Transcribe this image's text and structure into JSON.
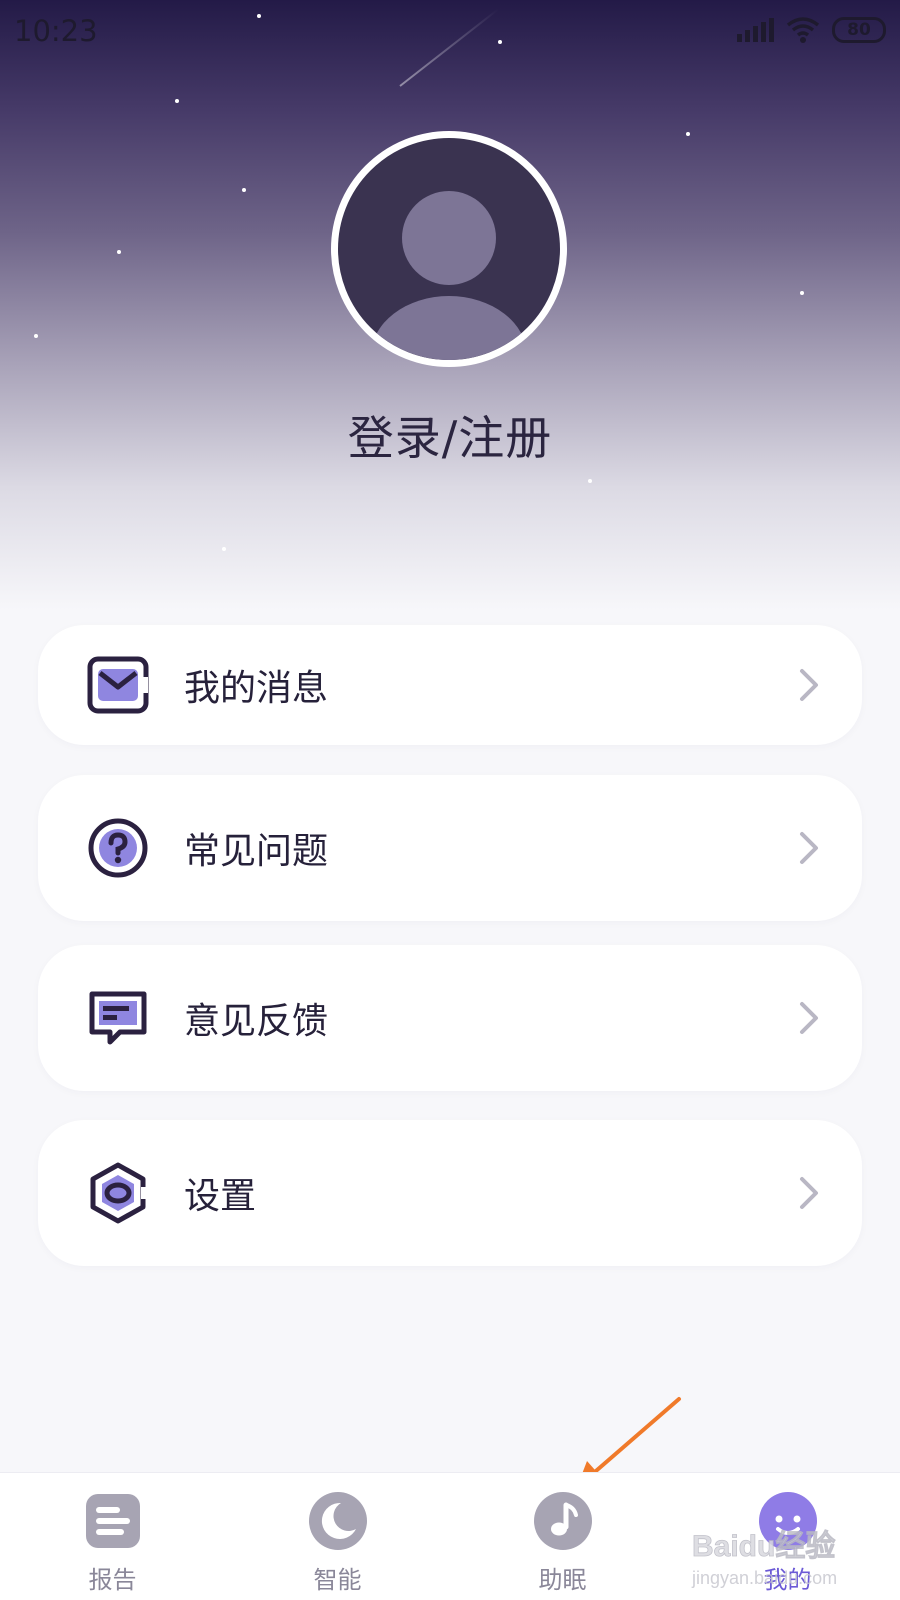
{
  "status_bar": {
    "time": "10:23",
    "battery": "80",
    "icons": [
      "signal-icon",
      "wifi-icon",
      "battery-icon"
    ]
  },
  "profile": {
    "login_label": "登录/注册"
  },
  "menu": {
    "items": [
      {
        "label": "我的消息",
        "icon": "message-icon"
      },
      {
        "label": "常见问题",
        "icon": "question-icon"
      },
      {
        "label": "意见反馈",
        "icon": "feedback-icon"
      },
      {
        "label": "设置",
        "icon": "settings-icon"
      }
    ]
  },
  "tabbar": {
    "tabs": [
      {
        "label": "报告",
        "icon": "report-icon",
        "active": false
      },
      {
        "label": "智能",
        "icon": "moon-icon",
        "active": false
      },
      {
        "label": "助眠",
        "icon": "music-note-icon",
        "active": false
      },
      {
        "label": "我的",
        "icon": "profile-face-icon",
        "active": true
      }
    ]
  },
  "watermark": {
    "brand": "Baidu经验",
    "url": "jingyan.baidu.com"
  },
  "colors": {
    "accent": "#6c5ad6",
    "icon_fill": "#8f86e0",
    "icon_stroke": "#2b2140",
    "tab_inactive": "#a7a4b3",
    "annotation_arrow": "#f07a2a"
  }
}
